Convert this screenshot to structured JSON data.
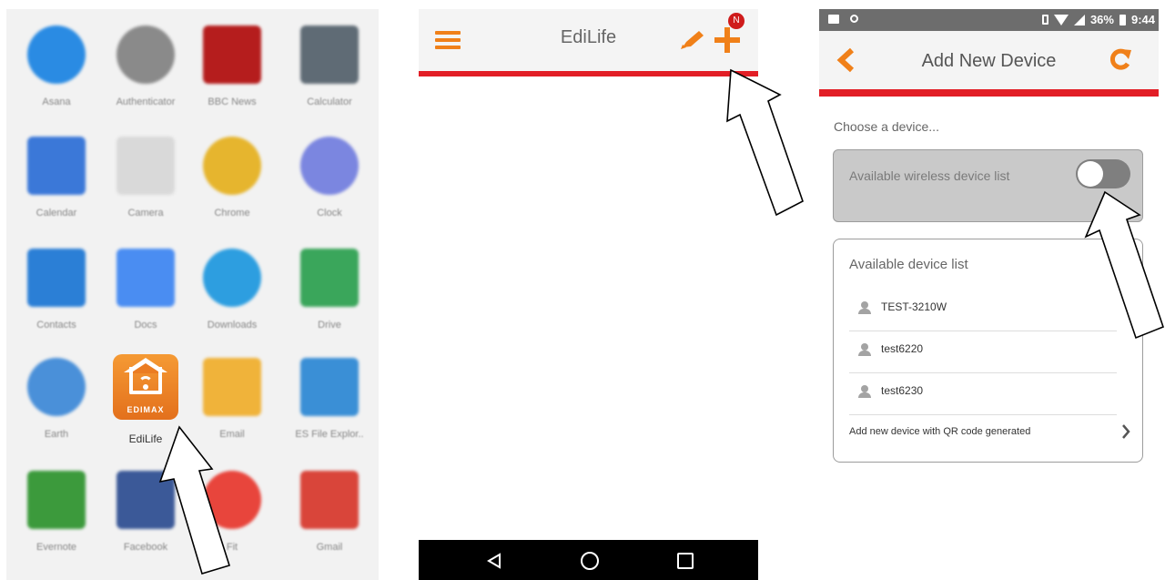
{
  "drawer": {
    "apps": [
      {
        "label": "Asana",
        "icon": "asana-icon",
        "color": "#2a8be3",
        "shape": "circle"
      },
      {
        "label": "Authenticator",
        "icon": "authenticator-icon",
        "color": "#8a8a8a",
        "shape": "circle"
      },
      {
        "label": "BBC News",
        "icon": "bbc-news-icon",
        "color": "#b51d1d",
        "shape": "square"
      },
      {
        "label": "Calculator",
        "icon": "calculator-icon",
        "color": "#5f6b75",
        "shape": "square"
      },
      {
        "label": "Calendar",
        "icon": "calendar-icon",
        "color": "#3b78d8",
        "shape": "square"
      },
      {
        "label": "Camera",
        "icon": "camera-icon",
        "color": "#d9d9d9",
        "shape": "square"
      },
      {
        "label": "Chrome",
        "icon": "chrome-icon",
        "color": "#e6b52e",
        "shape": "circle"
      },
      {
        "label": "Clock",
        "icon": "clock-icon",
        "color": "#7b86e0",
        "shape": "circle"
      },
      {
        "label": "Contacts",
        "icon": "contacts-icon",
        "color": "#2b7fd6",
        "shape": "square"
      },
      {
        "label": "Docs",
        "icon": "docs-icon",
        "color": "#4a8df2",
        "shape": "square"
      },
      {
        "label": "Downloads",
        "icon": "downloads-icon",
        "color": "#2d9ee0",
        "shape": "circle"
      },
      {
        "label": "Drive",
        "icon": "drive-icon",
        "color": "#3aa65b",
        "shape": "square"
      },
      {
        "label": "Earth",
        "icon": "earth-icon",
        "color": "#4a90d9",
        "shape": "circle"
      },
      {
        "label": "EdiLife",
        "icon": "edilife-icon",
        "color": "#ee7c22",
        "shape": "square"
      },
      {
        "label": "Email",
        "icon": "email-icon",
        "color": "#f0b33a",
        "shape": "square"
      },
      {
        "label": "ES File Explor..",
        "icon": "es-file-explorer-icon",
        "color": "#3a8fd6",
        "shape": "square"
      },
      {
        "label": "Evernote",
        "icon": "evernote-icon",
        "color": "#3c9a3c",
        "shape": "square"
      },
      {
        "label": "Facebook",
        "icon": "facebook-icon",
        "color": "#3b5998",
        "shape": "square"
      },
      {
        "label": "Fit",
        "icon": "fit-icon",
        "color": "#e8453c",
        "shape": "circle"
      },
      {
        "label": "Gmail",
        "icon": "gmail-icon",
        "color": "#d9453a",
        "shape": "square"
      }
    ],
    "edimax_brand": "EDIMAX"
  },
  "main_screen": {
    "title": "EdiLife",
    "badge": "N",
    "accent": "#f08019",
    "rule_color": "#e21e26"
  },
  "add_device": {
    "status_bar": {
      "battery": "36%",
      "time": "9:44"
    },
    "title": "Add New Device",
    "choose_text": "Choose a device...",
    "wireless_label": "Available wireless device list",
    "wireless_toggle_on": false,
    "device_list_title": "Available device list",
    "devices": [
      "TEST-3210W",
      "test6220",
      "test6230"
    ],
    "qr_label": "Add new device with QR code generated"
  }
}
